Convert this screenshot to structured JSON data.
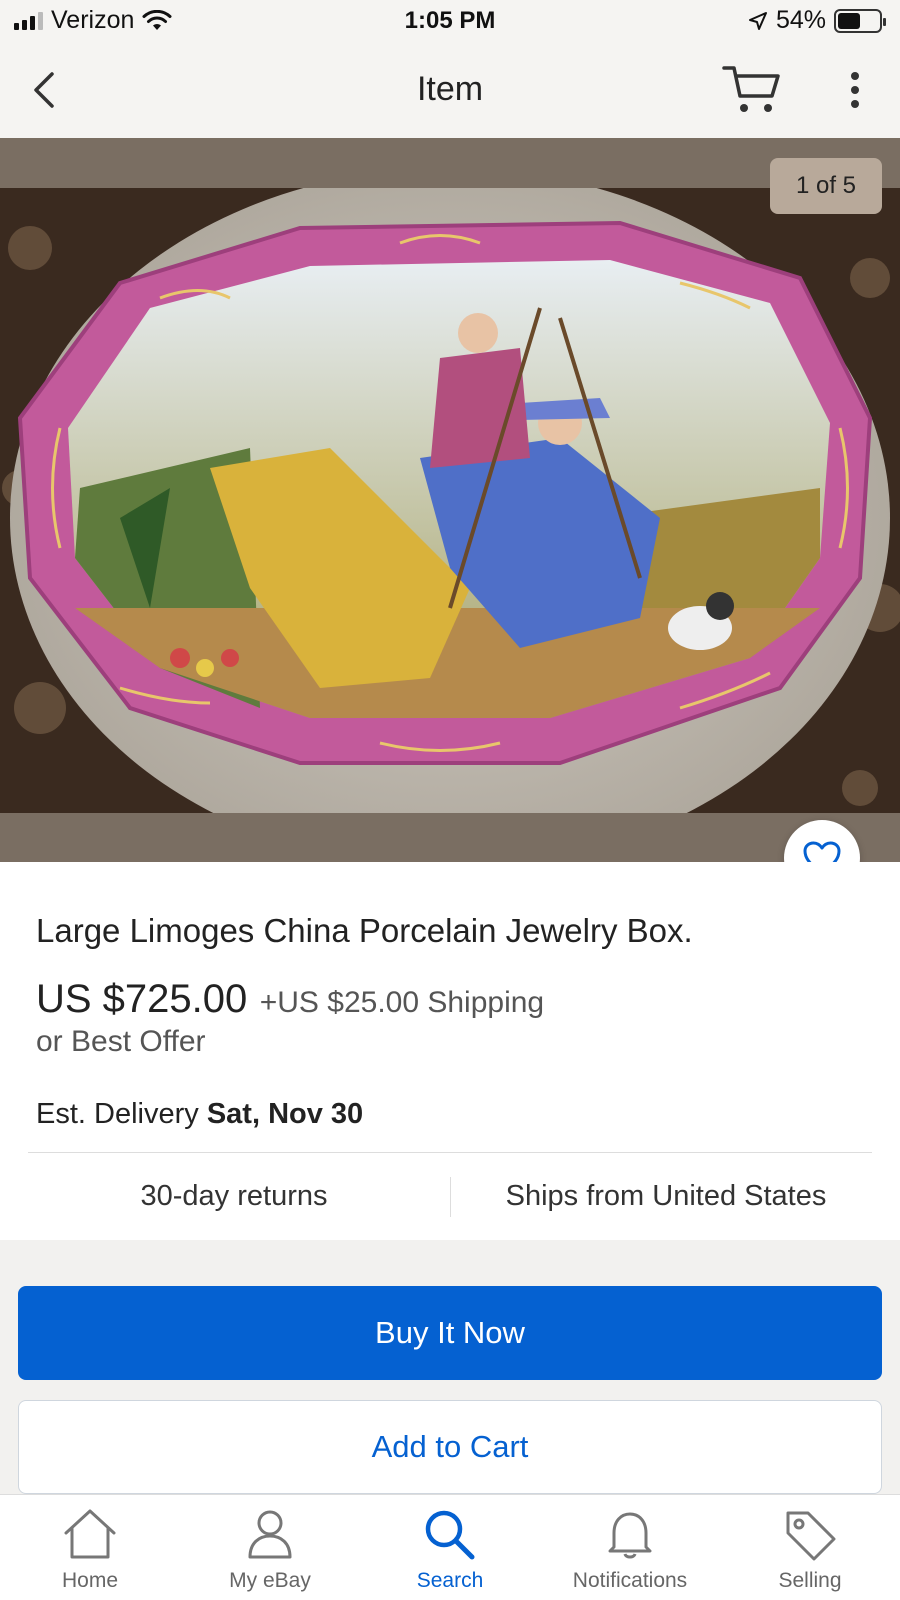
{
  "status_bar": {
    "carrier": "Verizon",
    "time": "1:05 PM",
    "battery": "54%",
    "battery_level": 0.54
  },
  "header": {
    "title": "Item"
  },
  "gallery": {
    "counter": "1 of 5",
    "favorited": false
  },
  "listing": {
    "title": "Large Limoges China Porcelain Jewelry Box.",
    "price": "US $725.00",
    "shipping": "+US $25.00 Shipping",
    "best_offer": "or Best Offer",
    "delivery_label": "Est. Delivery",
    "delivery_date": "Sat, Nov 30",
    "returns": "30-day returns",
    "ships_from": "Ships from United States"
  },
  "actions": {
    "buy_now": "Buy It Now",
    "add_to_cart": "Add to Cart"
  },
  "tabs": [
    {
      "label": "Home",
      "icon": "home-icon"
    },
    {
      "label": "My eBay",
      "icon": "person-icon"
    },
    {
      "label": "Search",
      "icon": "search-icon",
      "active": true
    },
    {
      "label": "Notifications",
      "icon": "bell-icon"
    },
    {
      "label": "Selling",
      "icon": "tag-icon"
    }
  ],
  "colors": {
    "accent": "#0561d1",
    "header_bg": "#f5f4f2",
    "gallery_bg": "#7a6e62"
  }
}
